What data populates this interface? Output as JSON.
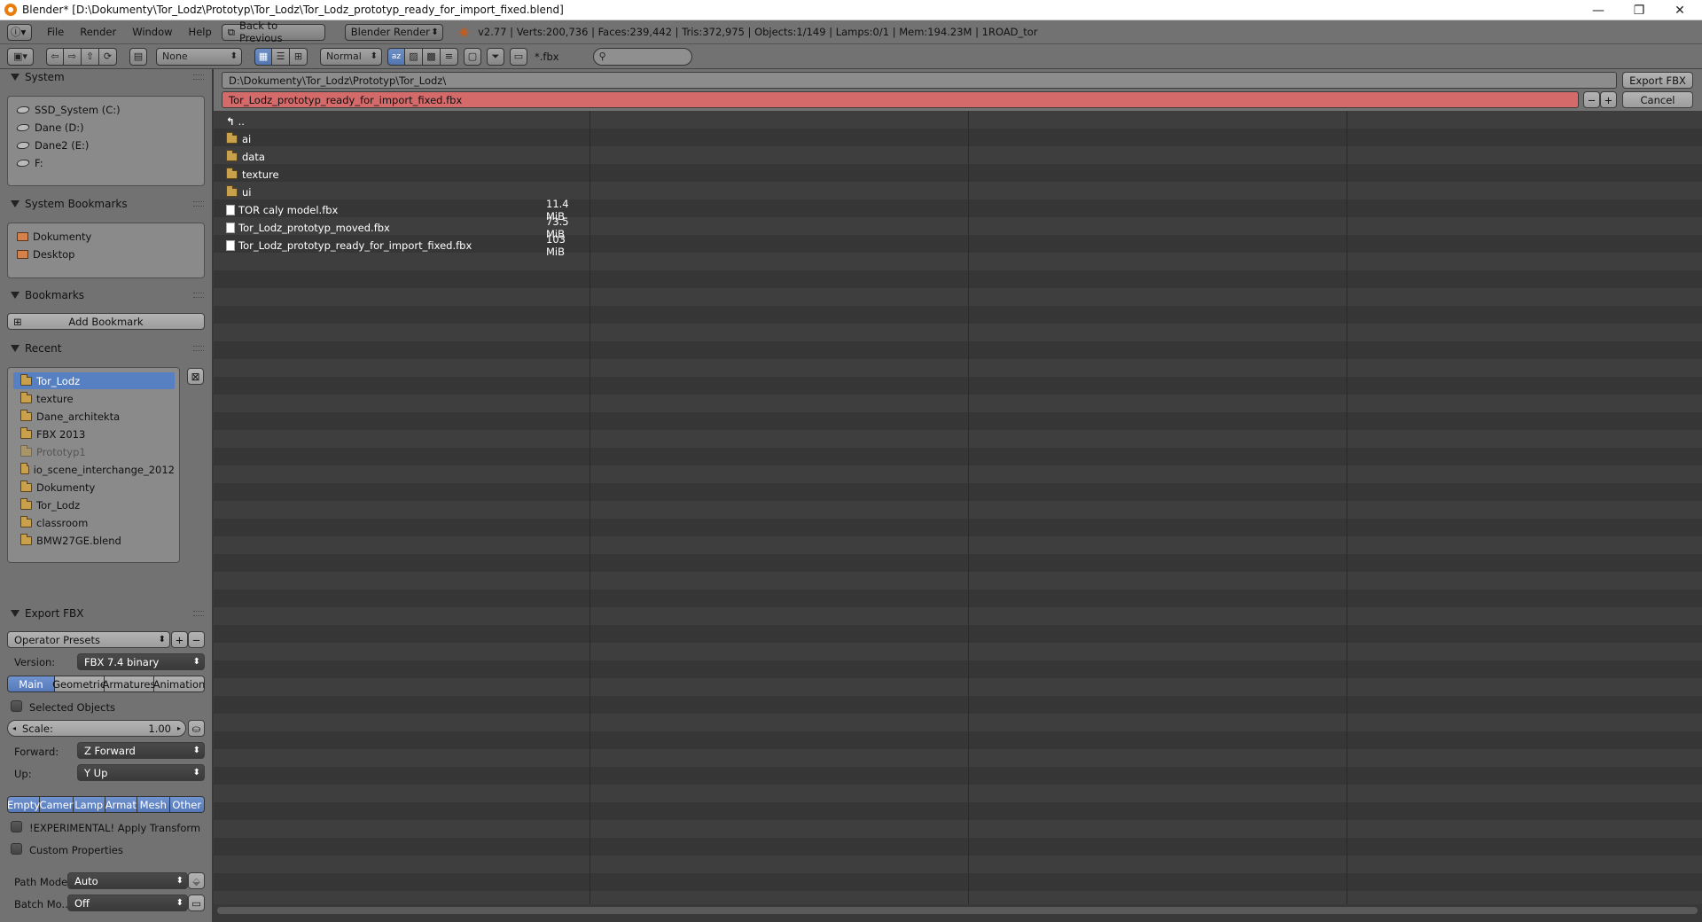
{
  "window": {
    "title": "Blender* [D:\\Dokumenty\\Tor_Lodz\\Prototyp\\Tor_Lodz\\Tor_Lodz_prototyp_ready_for_import_fixed.blend]",
    "minimize": "—",
    "restore": "❐",
    "close": "✕"
  },
  "info_header": {
    "menus": [
      "File",
      "Render",
      "Window",
      "Help"
    ],
    "back_button": "Back to Previous",
    "render_engine": "Blender Render",
    "stats": "v2.77 | Verts:200,736 | Faces:239,442 | Tris:372,975 | Objects:1/149 | Lamps:0/1 | Mem:194.23M | 1ROAD_tor"
  },
  "fb_header": {
    "recursion": "None",
    "thumbnail_size": "Normal",
    "filter_glob": "*.fbx",
    "search_placeholder": ""
  },
  "left_panel": {
    "system": {
      "title": "System",
      "items": [
        "SSD_System (C:)",
        "Dane (D:)",
        "Dane2 (E:)",
        "F:"
      ]
    },
    "system_bookmarks": {
      "title": "System Bookmarks",
      "items": [
        "Dokumenty",
        "Desktop"
      ]
    },
    "bookmarks": {
      "title": "Bookmarks",
      "add_label": "Add Bookmark"
    },
    "recent": {
      "title": "Recent",
      "items": [
        "Tor_Lodz",
        "texture",
        "Dane_architekta",
        "FBX 2013",
        "Prototyp1",
        "io_scene_interchange_2012",
        "Dokumenty",
        "Tor_Lodz",
        "classroom",
        "BMW27GE.blend"
      ],
      "selected_index": 0
    }
  },
  "export_fbx": {
    "title": "Export FBX",
    "operator_presets": "Operator Presets",
    "version_label": "Version:",
    "version_value": "FBX 7.4 binary",
    "tabs": [
      "Main",
      "Geometrie",
      "Armatures",
      "Animation"
    ],
    "active_tab": "Main",
    "selected_objects": "Selected Objects",
    "scale_label": "Scale:",
    "scale_value": "1.00",
    "forward_label": "Forward:",
    "forward_value": "Z Forward",
    "up_label": "Up:",
    "up_value": "Y Up",
    "object_types": [
      "Empty",
      "Camer",
      "Lamp",
      "Armat",
      "Mesh",
      "Other"
    ],
    "apply_transform": "!EXPERIMENTAL! Apply Transform",
    "custom_properties": "Custom Properties",
    "path_mode_label": "Path Mode:",
    "path_mode_value": "Auto",
    "batch_mode_label": "Batch Mo...",
    "batch_mode_value": "Off"
  },
  "main": {
    "directory": "D:\\Dokumenty\\Tor_Lodz\\Prototyp\\Tor_Lodz\\",
    "filename": "Tor_Lodz_prototyp_ready_for_import_fixed.fbx",
    "export_button": "Export FBX",
    "cancel_button": "Cancel",
    "parent_label": "..",
    "folders": [
      "ai",
      "data",
      "texture",
      "ui"
    ],
    "files": [
      {
        "name": "TOR caly model.fbx",
        "size": "11.4 MiB"
      },
      {
        "name": "Tor_Lodz_prototyp_moved.fbx",
        "size": "73.5 MiB"
      },
      {
        "name": "Tor_Lodz_prototyp_ready_for_import_fixed.fbx",
        "size": "103 MiB"
      }
    ]
  },
  "colors": {
    "selection": "#5680c2",
    "filename_error": "#d46a6a",
    "panel": "#727272",
    "list_bg": "#393939"
  }
}
